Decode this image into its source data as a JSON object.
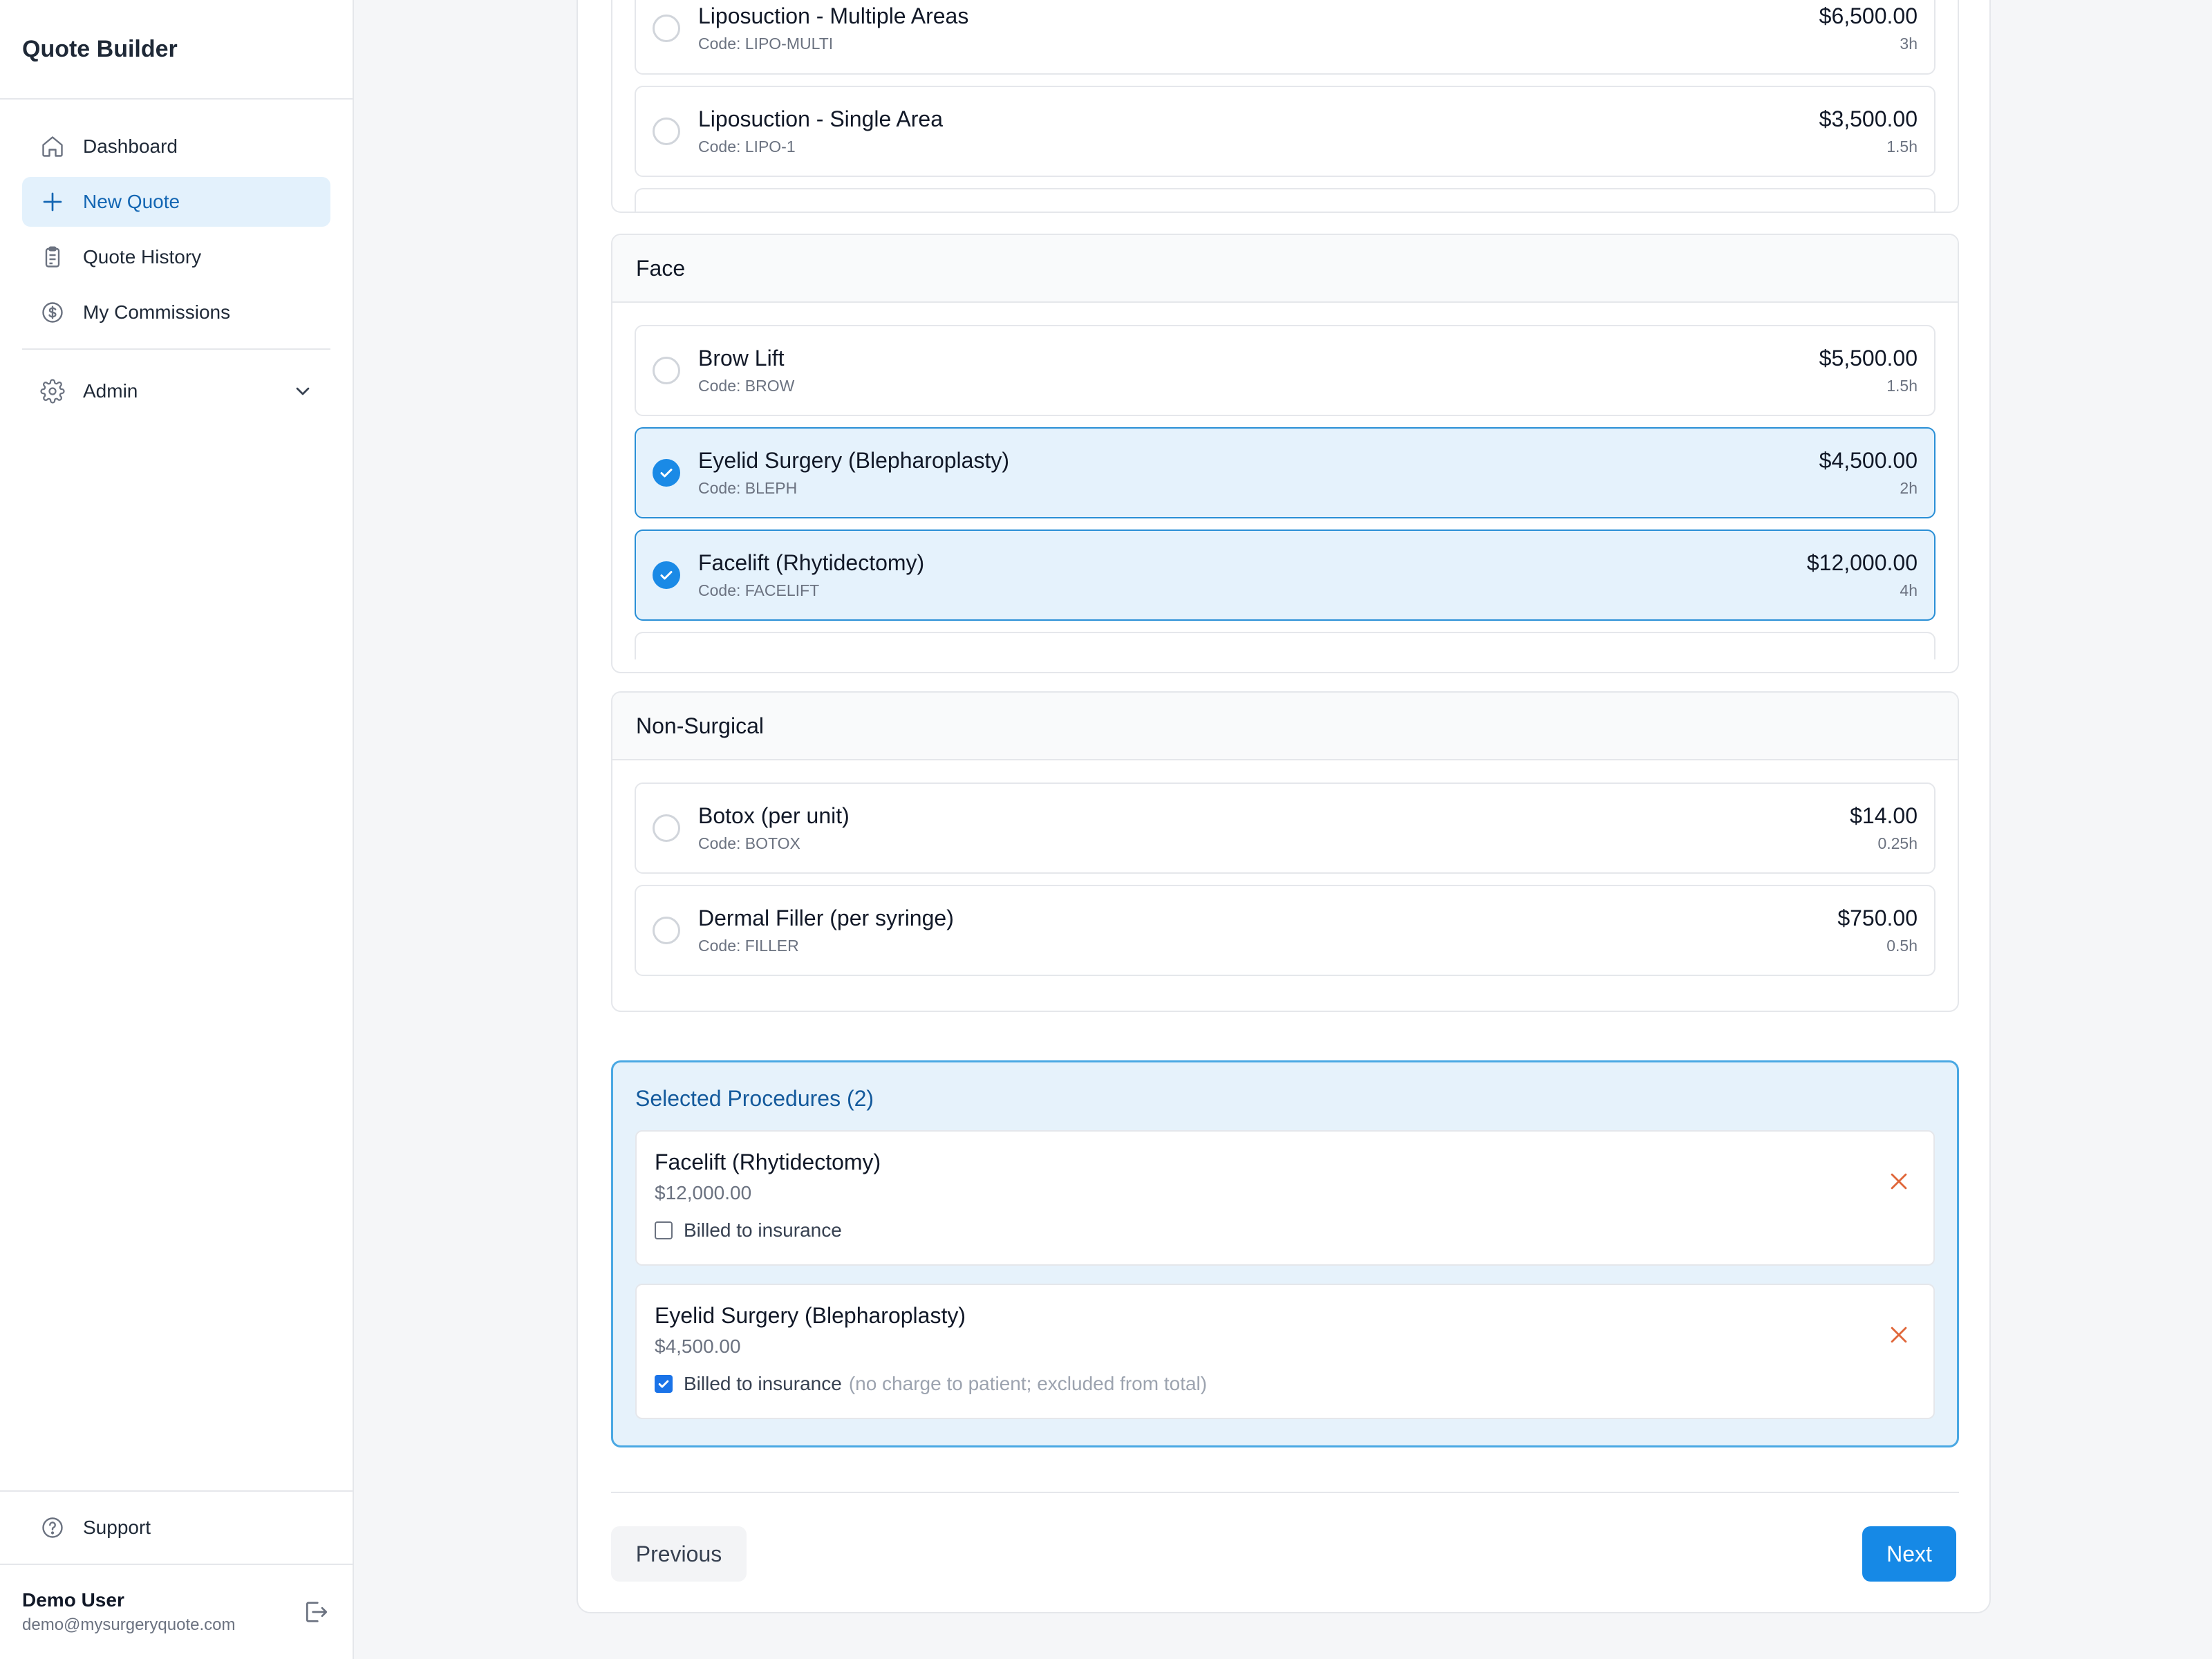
{
  "app": {
    "title": "Quote Builder"
  },
  "sidebar": {
    "items": [
      {
        "label": "Dashboard",
        "icon": "home-icon"
      },
      {
        "label": "New Quote",
        "icon": "plus-icon",
        "active": true
      },
      {
        "label": "Quote History",
        "icon": "clipboard-icon"
      },
      {
        "label": "My Commissions",
        "icon": "dollar-circle-icon"
      }
    ],
    "admin": {
      "label": "Admin",
      "icon": "gear-icon"
    },
    "support": {
      "label": "Support",
      "icon": "help-circle-icon"
    },
    "user": {
      "name": "Demo User",
      "email": "demo@mysurgeryquote.com"
    }
  },
  "groups": [
    {
      "name": "",
      "procedures": [
        {
          "name": "Liposuction - Multiple Areas",
          "code": "Code: LIPO-MULTI",
          "price": "$6,500.00",
          "duration": "3h",
          "selected": false
        },
        {
          "name": "Liposuction - Single Area",
          "code": "Code: LIPO-1",
          "price": "$3,500.00",
          "duration": "1.5h",
          "selected": false
        }
      ]
    },
    {
      "name": "Face",
      "procedures": [
        {
          "name": "Brow Lift",
          "code": "Code: BROW",
          "price": "$5,500.00",
          "duration": "1.5h",
          "selected": false
        },
        {
          "name": "Eyelid Surgery (Blepharoplasty)",
          "code": "Code: BLEPH",
          "price": "$4,500.00",
          "duration": "2h",
          "selected": true
        },
        {
          "name": "Facelift (Rhytidectomy)",
          "code": "Code: FACELIFT",
          "price": "$12,000.00",
          "duration": "4h",
          "selected": true
        }
      ]
    },
    {
      "name": "Non-Surgical",
      "procedures": [
        {
          "name": "Botox (per unit)",
          "code": "Code: BOTOX",
          "price": "$14.00",
          "duration": "0.25h",
          "selected": false
        },
        {
          "name": "Dermal Filler (per syringe)",
          "code": "Code: FILLER",
          "price": "$750.00",
          "duration": "0.5h",
          "selected": false
        }
      ]
    }
  ],
  "selected": {
    "title": "Selected Procedures (2)",
    "insurance_label": "Billed to insurance",
    "items": [
      {
        "name": "Facelift (Rhytidectomy)",
        "price": "$12,000.00",
        "billed_to_insurance": false,
        "note": ""
      },
      {
        "name": "Eyelid Surgery (Blepharoplasty)",
        "price": "$4,500.00",
        "billed_to_insurance": true,
        "note": "(no charge to patient; excluded from total)"
      }
    ]
  },
  "footer": {
    "previous_label": "Previous",
    "next_label": "Next"
  },
  "colors": {
    "accent": "#1689e6",
    "selected_bg": "#e5f2fc",
    "remove": "#e0673a"
  }
}
